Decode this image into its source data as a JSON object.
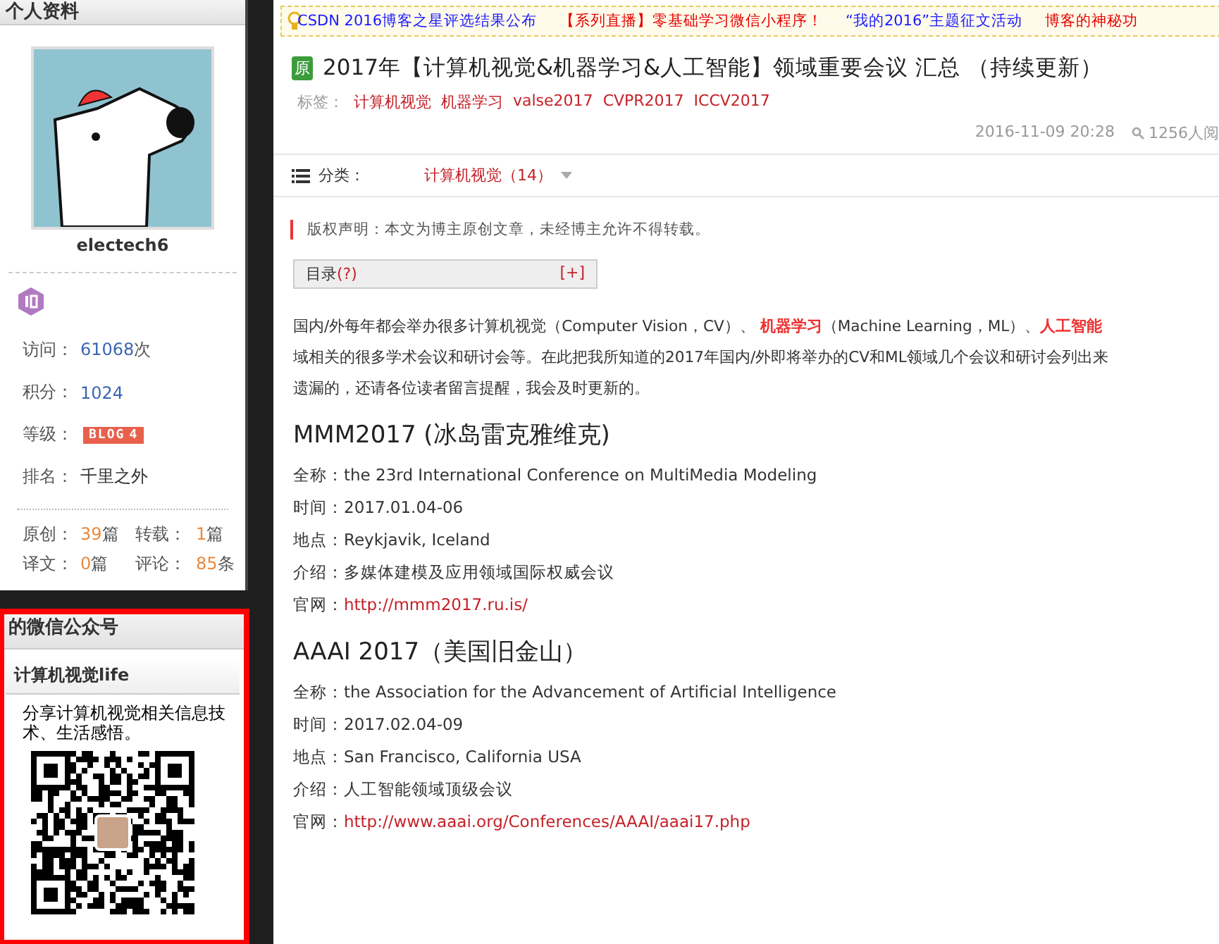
{
  "profile": {
    "header": "个人资料",
    "username": "electech6",
    "stats": [
      {
        "label": "访问：",
        "value": "61068",
        "unit": "次"
      },
      {
        "label": "积分：",
        "value": "1024"
      },
      {
        "label": "等级：",
        "badge_text": "BLOG",
        "badge_level": "4"
      },
      {
        "label": "排名：",
        "plain": "千里之外"
      }
    ],
    "counts": [
      [
        {
          "label": "原创：",
          "value": "39",
          "unit": "篇"
        },
        {
          "label": "转载：",
          "value": "1",
          "unit": "篇"
        }
      ],
      [
        {
          "label": "译文：",
          "value": "0",
          "unit": "篇"
        },
        {
          "label": "评论：",
          "value": "85",
          "unit": "条"
        }
      ]
    ]
  },
  "wechat": {
    "header": "的微信公众号",
    "account": "计算机视觉life",
    "description": "分享计算机视觉相关信息技术、生活感悟。"
  },
  "ticker": [
    {
      "text": "CSDN 2016博客之星评选结果公布",
      "color": "#1a1aff"
    },
    {
      "text": "【系列直播】零基础学习微信小程序！",
      "color": "#e60000"
    },
    {
      "text": "“我的2016”主题征文活动",
      "color": "#1a1aff"
    },
    {
      "text": "博客的神秘功",
      "color": "#e60000"
    }
  ],
  "article": {
    "badge": "原",
    "title": "2017年【计算机视觉&机器学习&人工智能】领域重要会议 汇总 （持续更新）",
    "tags_label": "标签：",
    "tags": [
      "计算机视觉",
      "机器学习",
      "valse2017",
      "CVPR2017",
      "ICCV2017"
    ],
    "date": "2016-11-09 20:28",
    "views": "1256人阅",
    "category_label": "分类：",
    "category": "计算机视觉（14）",
    "copyright": "版权声明：本文为博主原创文章，未经博主允许不得转载。",
    "toc": {
      "label": "目录",
      "help": "(?)",
      "toggle": "[+]"
    },
    "intro": [
      "国内/外每年都会举办很多计算机视觉（Computer Vision，CV）、 **机器学习**（Machine Learning，ML）、**人工智能**",
      "域相关的很多学术会议和研讨会等。在此把我所知道的2017年国内/外即将举办的CV和ML领域几个会议和研讨会列出来",
      "遗漏的，还请各位读者留言提醒，我会及时更新的。"
    ],
    "sections": [
      {
        "heading": "MMM2017 (冰岛雷克雅维克)",
        "fields": [
          {
            "label": "全称：",
            "value": "the 23rd International Conference on MultiMedia Modeling"
          },
          {
            "label": "时间：",
            "value": "2017.01.04-06"
          },
          {
            "label": "地点：",
            "value": "Reykjavik, Iceland"
          },
          {
            "label": "介绍：",
            "value": "多媒体建模及应用领域国际权威会议"
          },
          {
            "label": "官网：",
            "value": "http://mmm2017.ru.is/",
            "kind": "link"
          }
        ]
      },
      {
        "heading": "AAAI 2017（美国旧金山）",
        "fields": [
          {
            "label": "全称：",
            "value": "the Association for the Advancement of Artificial Intelligence"
          },
          {
            "label": "时间：",
            "value": "2017.02.04-09"
          },
          {
            "label": "地点：",
            "value": "San Francisco, California USA"
          },
          {
            "label": "介绍：",
            "value": "人工智能领域顶级会议"
          },
          {
            "label": "官网：",
            "value": "http://www.aaai.org/Conferences/AAAI/aaai17.php",
            "kind": "link"
          }
        ]
      }
    ]
  }
}
